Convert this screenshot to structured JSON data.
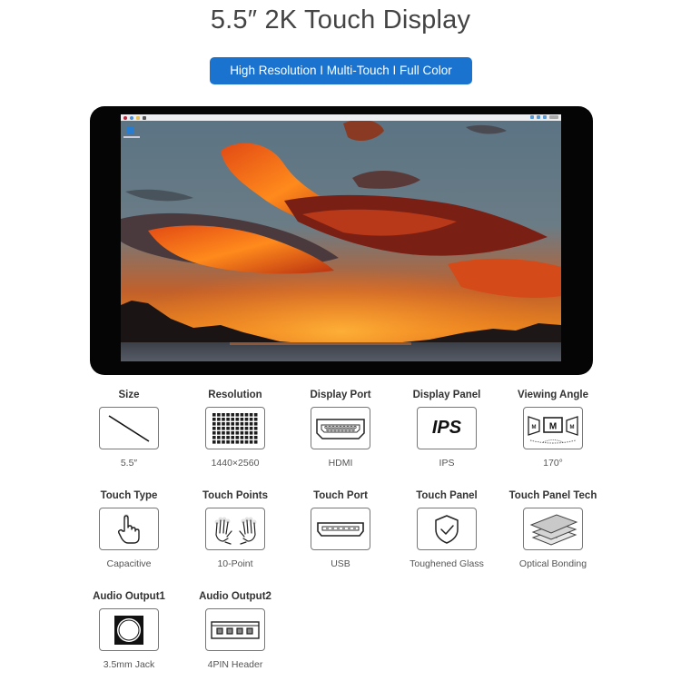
{
  "header": {
    "title": "5.5″ 2K Touch Display",
    "tagline": "High Resolution I Multi-Touch I Full Color",
    "accent_color": "#1a73cf"
  },
  "display": {
    "image": "sunset-over-mountains-and-lake",
    "desktop_icon": "trash-icon"
  },
  "specs": [
    {
      "label": "Size",
      "value": "5.5″",
      "icon": "diagonal-line-icon"
    },
    {
      "label": "Resolution",
      "value": "1440×2560",
      "icon": "pixel-grid-icon"
    },
    {
      "label": "Display Port",
      "value": "HDMI",
      "icon": "hdmi-port-icon"
    },
    {
      "label": "Display Panel",
      "value": "IPS",
      "icon": "ips-text-icon",
      "icon_text": "IPS"
    },
    {
      "label": "Viewing Angle",
      "value": "170°",
      "icon": "viewing-angle-icon",
      "icon_text": "M"
    },
    {
      "label": "Touch Type",
      "value": "Capacitive",
      "icon": "finger-touch-icon"
    },
    {
      "label": "Touch Points",
      "value": "10-Point",
      "icon": "two-hands-icon"
    },
    {
      "label": "Touch Port",
      "value": "USB",
      "icon": "usb-port-icon"
    },
    {
      "label": "Touch Panel",
      "value": "Toughened Glass",
      "icon": "shield-check-icon"
    },
    {
      "label": "Touch Panel Tech",
      "value": "Optical Bonding",
      "icon": "layered-panels-icon"
    },
    {
      "label": "Audio Output1",
      "value": "3.5mm Jack",
      "icon": "audio-jack-icon"
    },
    {
      "label": "Audio Output2",
      "value": "4PIN Header",
      "icon": "pin-header-icon"
    }
  ]
}
